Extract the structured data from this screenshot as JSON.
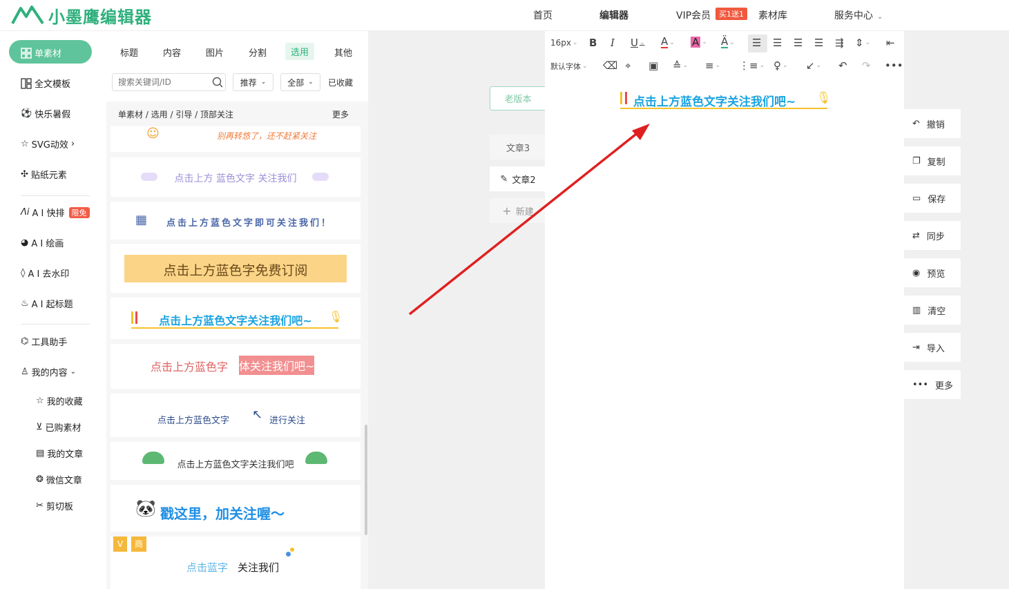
{
  "header": {
    "logo_text": "小墨鹰编辑器",
    "nav": [
      "首页",
      "编辑器",
      "VIP会员",
      "素材库",
      "服务中心"
    ],
    "vip_badge": "买1送1"
  },
  "sidebar": {
    "items": [
      "单素材",
      "全文模板",
      "快乐暑假",
      "SVG动效",
      "贴纸元素",
      "A I 快排",
      "A I 绘画",
      "A I 去水印",
      "A I 起标题",
      "工具助手",
      "我的内容"
    ],
    "limit_badge": "限免",
    "sub_items": [
      "我的收藏",
      "已购素材",
      "我的文章",
      "微信文章",
      "剪切板"
    ]
  },
  "panel": {
    "tabs": [
      "标题",
      "内容",
      "图片",
      "分割",
      "选用",
      "其他"
    ],
    "search_placeholder": "搜索关键词/ID",
    "filters": [
      "推荐",
      "全部",
      "已收藏"
    ],
    "breadcrumb": "单素材 / 选用 / 引导 / 顶部关注",
    "more": "更多",
    "cards": [
      "别再转悠了，还不赶紧关注",
      "点击上方 蓝色文字 关注我们",
      "点击上方蓝色文字即可关注我们！",
      "点击上方蓝色字免费订阅",
      "点击上方蓝色文字关注我们吧~",
      "点击上方蓝色字",
      "体关注我们吧~",
      "点击上方蓝色文字",
      "进行关注",
      "点击上方蓝色文字关注我们吧",
      "戳这里，加关注喔～",
      "点击蓝字",
      "关注我们"
    ],
    "card_badges": [
      "V",
      "商"
    ]
  },
  "workspace": {
    "old_version": "老版本",
    "doc_tabs": [
      "文章3",
      "文章2",
      "新建"
    ]
  },
  "editor": {
    "font_size": "16px",
    "font_family": "默认字体",
    "content_text": "点击上方蓝色文字关注我们吧~"
  },
  "right_actions": [
    "撤销",
    "复制",
    "保存",
    "同步",
    "预览",
    "清空",
    "导入",
    "更多"
  ],
  "colors": {
    "brand": "#2fb07d",
    "accent_blue": "#1aa3e0",
    "arrow_red": "#e02020"
  }
}
